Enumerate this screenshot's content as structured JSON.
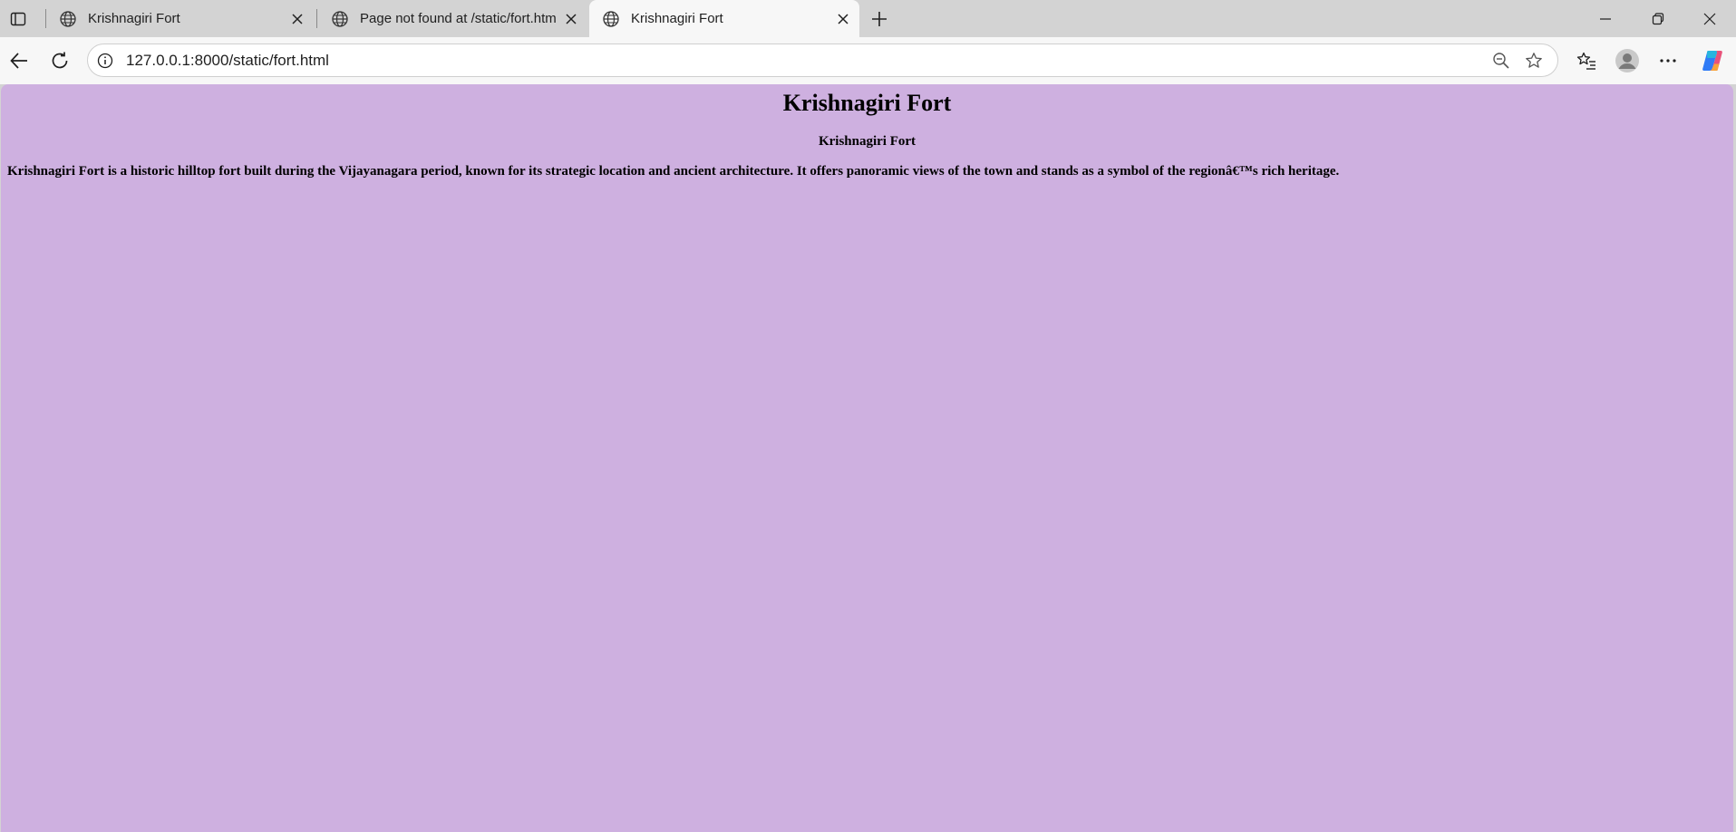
{
  "browser": {
    "tabs": [
      {
        "title": "Krishnagiri Fort",
        "icon": "globe-icon",
        "active": false
      },
      {
        "title": "Page not found at /static/fort.htm",
        "icon": "globe-icon",
        "active": false
      },
      {
        "title": "Krishnagiri Fort",
        "icon": "globe-icon",
        "active": true
      }
    ],
    "address": {
      "url": "127.0.0.1:8000/static/fort.html"
    }
  },
  "page": {
    "background": "#ceb0e0",
    "heading": "Krishnagiri Fort",
    "subheading": "Krishnagiri Fort",
    "paragraph": "Krishnagiri Fort is a historic hilltop fort built during the Vijayanagara period, known for its strategic location and ancient architecture. It offers panoramic views of the town and stands as a symbol of the regionâ€™s rich heritage."
  }
}
